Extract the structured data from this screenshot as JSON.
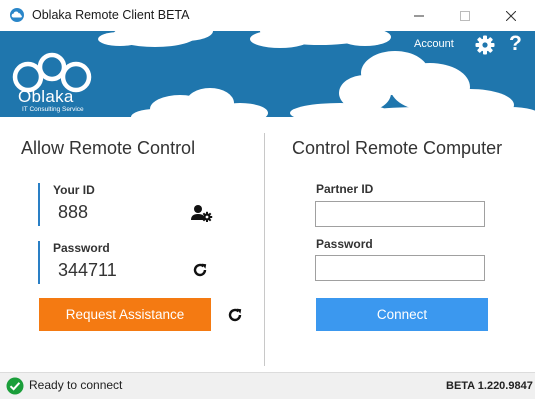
{
  "window": {
    "title": "Oblaka Remote Client BETA"
  },
  "banner": {
    "logo_name": "Oblaka",
    "logo_subtitle": "IT Consulting Service",
    "account_label": "Account",
    "help_label": "?",
    "background_color": "#1f76ad"
  },
  "allow": {
    "title": "Allow Remote Control",
    "your_id_label": "Your ID",
    "your_id_value": "888",
    "password_label": "Password",
    "password_value": "344711",
    "request_button_label": "Request Assistance",
    "request_button_color": "#f47a12"
  },
  "control": {
    "title": "Control Remote Computer",
    "partner_id_label": "Partner ID",
    "partner_id_value": "",
    "password_label": "Password",
    "password_value": "",
    "connect_button_label": "Connect",
    "connect_button_color": "#3b98ef"
  },
  "status": {
    "text": "Ready to connect",
    "version": "BETA 1.220.9847",
    "status_color": "#1a9e3a"
  },
  "icons": [
    "cloud-app-icon",
    "minimize-icon",
    "maximize-icon",
    "close-icon",
    "gear-icon",
    "user-gear-icon",
    "refresh-icon",
    "check-circle-icon"
  ]
}
